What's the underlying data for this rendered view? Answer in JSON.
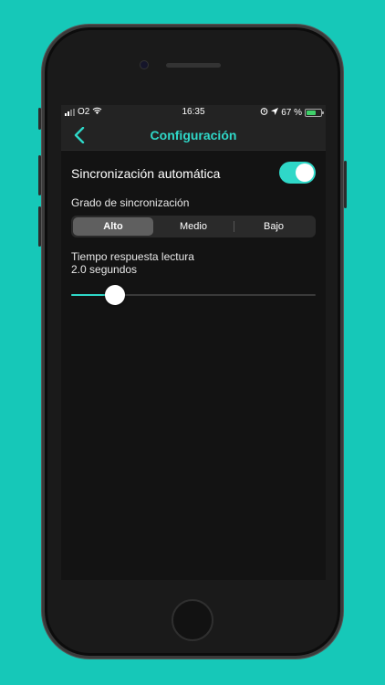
{
  "status_bar": {
    "carrier": "O2",
    "time": "16:35",
    "battery_percent": "67 %",
    "battery_level": 0.67,
    "signal_bars": 2
  },
  "nav": {
    "back_icon": "chevron-left-icon",
    "title": "Configuración"
  },
  "settings": {
    "auto_sync_label": "Sincronización automática",
    "auto_sync_enabled": true,
    "sync_degree_label": "Grado de sincronización",
    "sync_degree_options": [
      "Alto",
      "Medio",
      "Bajo"
    ],
    "sync_degree_selected": "Alto",
    "response_time_label": "Tiempo respuesta lectura",
    "response_time_value": "2.0 segundos",
    "response_time_slider_fraction": 0.18
  },
  "colors": {
    "accent": "#2fd8c8",
    "background": "#16c8b8",
    "screen_bg": "#131313",
    "bar_bg": "#232323"
  }
}
